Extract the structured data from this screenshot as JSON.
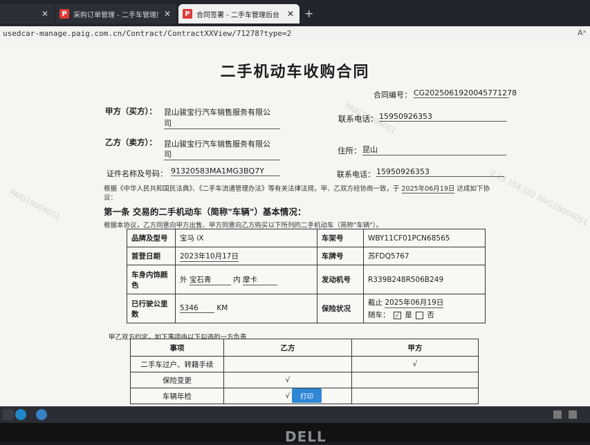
{
  "browser": {
    "tabs": [
      {
        "label": "",
        "active": false
      },
      {
        "label": "采购订单管理 - 二手车管理后台",
        "active": false
      },
      {
        "label": "合同签署 - 二手车管理后台",
        "active": true
      }
    ],
    "url": "usedcar-manage.paig.com.cn/Contract/ContractXXView/71278?type=2",
    "read_mode": "Aᵃ"
  },
  "contract": {
    "title": "二手机动车收购合同",
    "number_label": "合同编号：",
    "number": "CG2025061920045771278",
    "party_a_label": "甲方（买方）：",
    "party_a_line1": "昆山骏宝行汽车销售服务有限公",
    "party_a_line2": "司",
    "party_a_phone_label": "联系电话：",
    "party_a_phone": "15950926353",
    "party_b_label": "乙方（卖方）：",
    "party_b_line1": "昆山骏宝行汽车销售服务有限公",
    "party_b_line2": "司",
    "party_b_addr_label": "住所：",
    "party_b_addr": "昆山",
    "id_label": "证件名称及号码：",
    "id_value": "91320583MA1MG3BQ7Y",
    "party_b_phone_label": "联系电话：",
    "party_b_phone": "15950926353",
    "intro_line1_before": "根据《中华人民共和国民法典》、《二手车流通管理办法》等有关法律法规，甲、乙双方经协商一致，于",
    "intro_date": "2025年06月19日",
    "intro_line1_after": "达成如下协",
    "intro_line2": "议：",
    "section1_title": "第一条 交易的二手机动车（简称\"车辆\"）基本情况：",
    "section1_desc": "根据本协议，乙方同意向甲方出售、甲方同意向乙方购买以下所列的二手机动车（简称\"车辆\"）。",
    "vehicle": {
      "brand_label": "品牌及型号",
      "brand": "宝马 iX",
      "vin_label": "车架号",
      "vin": "WBY11CF01PCN68565",
      "reg_label": "首登日期",
      "reg_date": "2023年10月17日",
      "plate_label": "车牌号",
      "plate": "苏FDQ5767",
      "color_label": "车身内饰颜色",
      "color_out_label": "外",
      "color_out": "宝石青",
      "color_in_label": "内",
      "color_in": "摩卡",
      "engine_label": "发动机号",
      "engine": "R339B248R506B249",
      "mileage_label": "已行驶公里数",
      "mileage": "5346",
      "mileage_unit": "KM",
      "insurance_label": "保险状况",
      "insurance_until_label": "截止",
      "insurance_until": "2025年06月19日",
      "with_car_label": "随车：",
      "yes_label": "是",
      "no_label": "否",
      "yes_mark": "√"
    },
    "resp_intro": "甲乙双方约定，如下事项由以下勾选的一方负责",
    "resp_headers": [
      "事项",
      "乙方",
      "甲方"
    ],
    "resp_rows": [
      {
        "item": "二手车过户、转籍手续",
        "b": "",
        "a": "√"
      },
      {
        "item": "保险变更",
        "b": "√",
        "a": ""
      },
      {
        "item": "车辆年检",
        "b": "√",
        "a": ""
      }
    ],
    "print_label": "打印"
  },
  "watermark": {
    "texts": [
      "PAIG190040S1",
      "PAIG19004051",
      "2.19.154.102 PAIG19004051"
    ]
  },
  "bezel": {
    "brand": "DELL"
  }
}
